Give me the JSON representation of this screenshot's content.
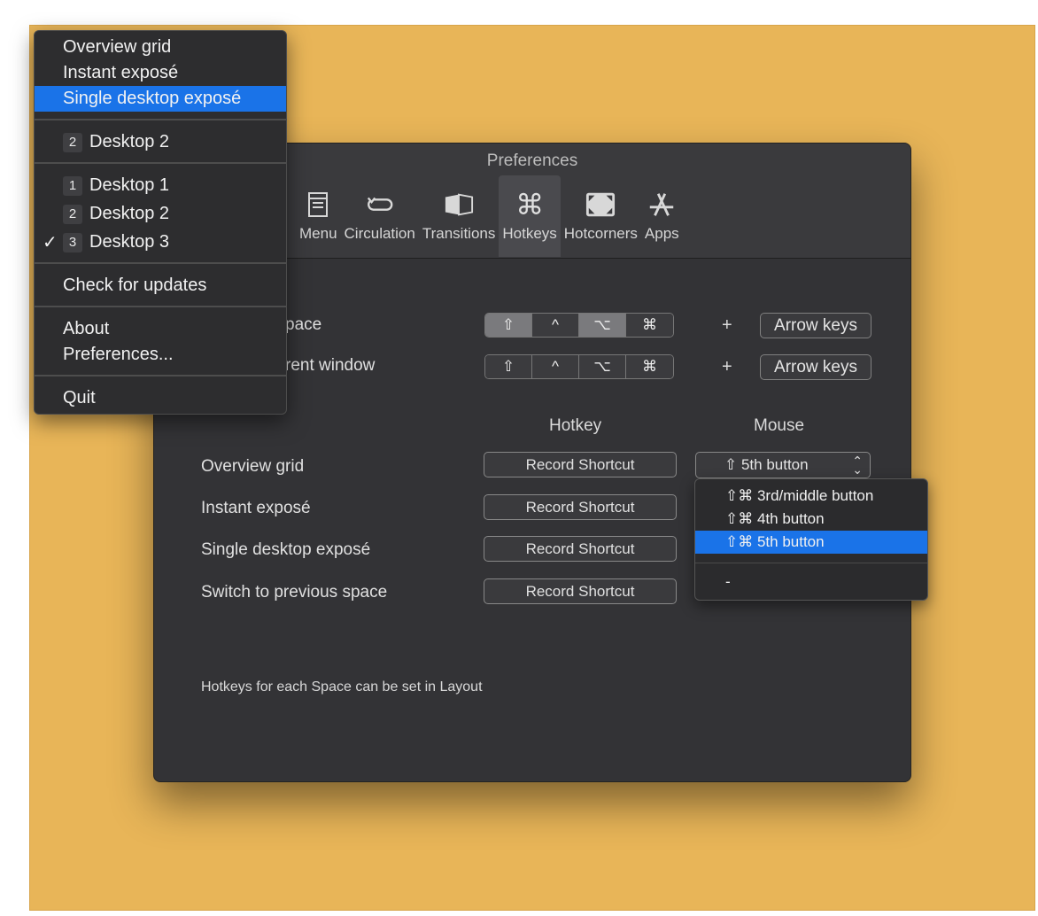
{
  "window": {
    "title": "Preferences",
    "toolbar": [
      {
        "label": "Menu",
        "icon": "menu-icon"
      },
      {
        "label": "Circulation",
        "icon": "circulation-icon"
      },
      {
        "label": "Transitions",
        "icon": "transitions-icon"
      },
      {
        "label": "Hotkeys",
        "icon": "command-key-icon",
        "active": true
      },
      {
        "label": "Hotcorners",
        "icon": "hotcorners-icon"
      },
      {
        "label": "Apps",
        "icon": "apps-icon"
      }
    ]
  },
  "hotkeys": {
    "row1": {
      "label": "pace",
      "modifiers": [
        "⇧",
        "^",
        "⌥",
        "⌘"
      ],
      "plus": "+",
      "keys": "Arrow keys"
    },
    "row2": {
      "label": "rent window",
      "modifiers": [
        "⇧",
        "^",
        "⌥",
        "⌘"
      ],
      "plus": "+",
      "keys": "Arrow keys"
    },
    "col_hotkey": "Hotkey",
    "col_mouse": "Mouse",
    "actions": [
      {
        "label": "Overview grid",
        "button": "Record Shortcut"
      },
      {
        "label": "Instant exposé",
        "button": "Record Shortcut"
      },
      {
        "label": "Single desktop exposé",
        "button": "Record Shortcut"
      },
      {
        "label": "Switch to previous space",
        "button": "Record Shortcut"
      }
    ],
    "mouse_popup_value": "⇧ 5th button",
    "footnote": "Hotkeys for each Space can be set in Layout"
  },
  "dropdown": {
    "items": [
      "⇧⌘ 3rd/middle button",
      "⇧⌘ 4th button",
      "⇧⌘ 5th button"
    ],
    "selected_index": 2,
    "extra": "-"
  },
  "menu": {
    "group1": [
      "Overview grid",
      "Instant exposé",
      "Single desktop exposé"
    ],
    "group1_selected": 2,
    "current": {
      "num": "2",
      "label": "Desktop 2"
    },
    "desktops": [
      {
        "num": "1",
        "label": "Desktop 1"
      },
      {
        "num": "2",
        "label": "Desktop 2"
      },
      {
        "num": "3",
        "label": "Desktop 3",
        "checked": true
      }
    ],
    "check": "✓",
    "updates": "Check for updates",
    "about": "About",
    "preferences": "Preferences...",
    "quit": "Quit"
  },
  "colors": {
    "background": "#e8b558",
    "window": "#333336",
    "accent": "#1a73e8"
  }
}
